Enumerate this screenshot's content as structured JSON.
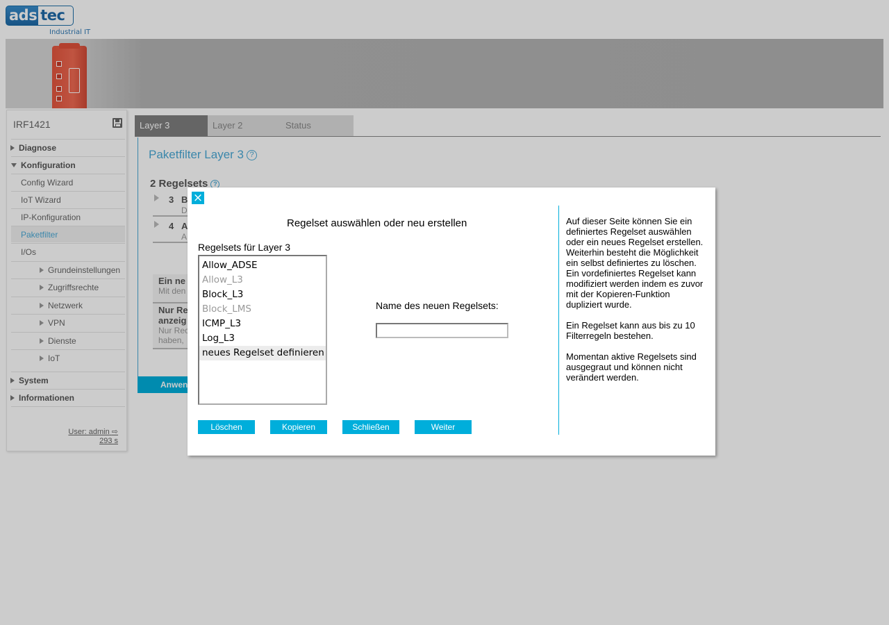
{
  "header": {
    "logo_part1": "ads",
    "logo_part2": "tec",
    "logo_sub": "Industrial IT"
  },
  "sidebar": {
    "device_name": "IRF1421",
    "items": [
      {
        "label": "Diagnose"
      },
      {
        "label": "Konfiguration"
      },
      {
        "label": "Config Wizard"
      },
      {
        "label": "IoT Wizard"
      },
      {
        "label": "IP-Konfiguration"
      },
      {
        "label": "Paketfilter"
      },
      {
        "label": "I/Os"
      },
      {
        "label": "Grundeinstellungen"
      },
      {
        "label": "Zugriffsrechte"
      },
      {
        "label": "Netzwerk"
      },
      {
        "label": "VPN"
      },
      {
        "label": "Dienste"
      },
      {
        "label": "IoT"
      },
      {
        "label": "System"
      },
      {
        "label": "Informationen"
      }
    ],
    "user": "User: admin",
    "timer": "293 s"
  },
  "tabs": [
    {
      "label": "Layer 3"
    },
    {
      "label": "Layer 2"
    },
    {
      "label": "Status"
    }
  ],
  "main": {
    "title": "Paketfilter Layer 3",
    "help_glyph": "?",
    "ruleset_count": "2 Regelsets",
    "rows": [
      {
        "number": "3",
        "initial": "B",
        "desc_initial": "D"
      },
      {
        "number": "4",
        "initial": "A",
        "desc_initial": "A"
      }
    ],
    "info1_heading": "Ein ne",
    "info1_text": "Mit den",
    "info2_heading_line1": "Nur Re",
    "info2_heading_line2": "anzeig",
    "info2_text_line1": "Nur Rec",
    "info2_text_line2": "haben,",
    "apply_label": "Anwen"
  },
  "modal": {
    "close_glyph": "×",
    "title": "Regelset auswählen oder neu erstellen",
    "list_label": "Regelsets für Layer 3",
    "rulesets": [
      {
        "name": "Allow_ADSE",
        "disabled": false,
        "selected": false
      },
      {
        "name": "Allow_L3",
        "disabled": true,
        "selected": false
      },
      {
        "name": "Block_L3",
        "disabled": false,
        "selected": false
      },
      {
        "name": "Block_LMS",
        "disabled": true,
        "selected": false
      },
      {
        "name": "ICMP_L3",
        "disabled": false,
        "selected": false
      },
      {
        "name": "Log_L3",
        "disabled": false,
        "selected": false
      },
      {
        "name": "neues Regelset definieren",
        "disabled": false,
        "selected": true
      }
    ],
    "name_label": "Name des neuen Regelsets:",
    "name_value": "",
    "buttons": {
      "delete": "Löschen",
      "copy": "Kopieren",
      "close": "Schließen",
      "next": "Weiter"
    },
    "help_paragraphs": [
      "Auf dieser Seite können Sie ein definiertes Regelset auswählen oder ein neues Regelset erstellen. Weiterhin besteht die Möglichkeit ein selbst definiertes zu löschen. Ein vordefiniertes Regelset kann modifiziert werden indem es zuvor mit der Kopieren-Funktion dupliziert wurde.",
      "Ein Regelset kann aus bis zu 10 Filterregeln bestehen.",
      "Momentan aktive Regelsets sind ausgegraut und können nicht verändert werden."
    ]
  },
  "colors": {
    "accent": "#00aedb",
    "title_blue": "#4aa9d6",
    "active_tab": "#7f7f7f",
    "device": "#e4553e"
  }
}
